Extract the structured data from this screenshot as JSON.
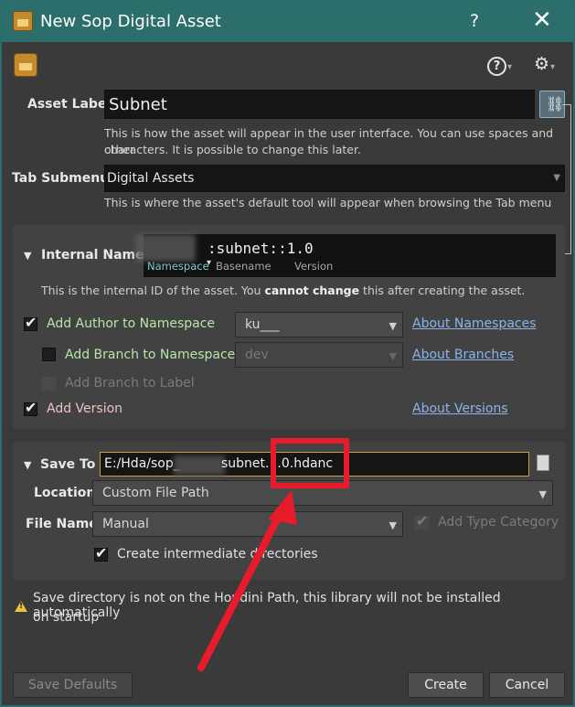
{
  "window": {
    "title": "New Sop Digital Asset",
    "help": "?",
    "close": "✕"
  },
  "toolbar": {
    "help_icon": "?",
    "gear_icon": "⚙",
    "caret": "▾"
  },
  "asset_label": {
    "label": "Asset Label",
    "value": "Subnet",
    "hint_line1": "This is how the asset will appear in the user interface. You can use spaces and other",
    "hint_line2": "characters. It is possible to change this later.",
    "link_icon": "🔗"
  },
  "tab_submenu": {
    "label": "Tab Submenu",
    "value": "Digital Assets",
    "hint": "This is where the asset's default tool will appear when browsing the Tab menu"
  },
  "internal_name": {
    "label": "Internal Name",
    "value": ":subnet::1.0",
    "namespace_caption": "Namespace",
    "namespace_caret": "▾",
    "basename_caption": "Basename",
    "version_caption": "Version",
    "hint_pre": "This is the internal ID of the asset. You ",
    "hint_bold": "cannot change",
    "hint_post": " this after creating the asset."
  },
  "options": {
    "add_author": {
      "label": "Add Author to Namespace",
      "checked": true,
      "value": "ku___",
      "link": "About Namespaces"
    },
    "add_branch": {
      "label": "Add Branch to Namespace",
      "checked": false,
      "value": "dev",
      "link": "About Branches"
    },
    "add_branch_label": {
      "label": "Add Branch to Label",
      "checked": false
    },
    "add_version": {
      "label": "Add Version",
      "checked": true,
      "link": "About Versions"
    }
  },
  "save": {
    "label": "Save To",
    "path_prefix": "E:/Hda/sop_",
    "path_suffix": "subnet.1.0.hdanc",
    "location_label": "Location",
    "location_value": "Custom File Path",
    "file_name_label": "File Name",
    "file_name_value": "Manual",
    "add_type_category": "Add Type Category",
    "create_dirs": "Create intermediate directories"
  },
  "warning": {
    "line1": "Save directory is not on the Houdini Path, this library will not be installed automatically",
    "line2": "on startup"
  },
  "buttons": {
    "save_defaults": "Save Defaults",
    "create": "Create",
    "cancel": "Cancel"
  },
  "colors": {
    "titlebar": "#2c6e6c",
    "annotation": "#e81b2a",
    "link": "#8ab4e8"
  }
}
